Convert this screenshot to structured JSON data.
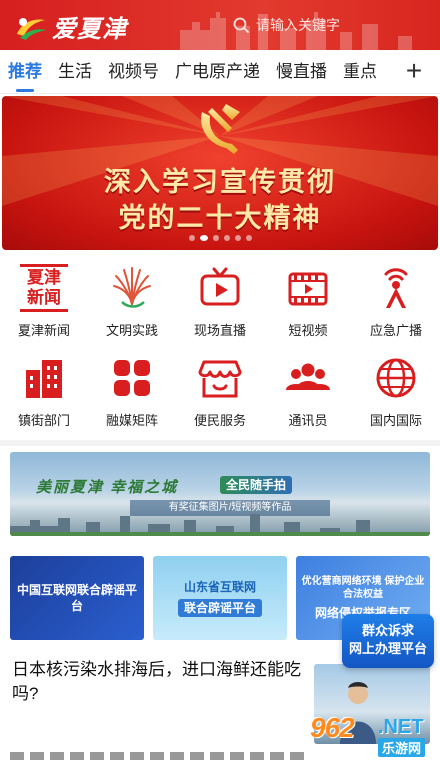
{
  "header": {
    "app_name": "爱夏津",
    "search_placeholder": "请输入关键字",
    "brand_color": "#d61f1f"
  },
  "tabs": {
    "items": [
      "推荐",
      "生活",
      "视频号",
      "广电原产递",
      "慢直播",
      "重点"
    ],
    "active_index": 0,
    "add_icon": "plus-icon",
    "active_color": "#2a7ae2"
  },
  "banner": {
    "line1": "深入学习宣传贯彻",
    "line2": "党的二十大精神",
    "emblem": "party-emblem-icon",
    "slide_count": 6,
    "active_slide": 1
  },
  "grid": {
    "row1": [
      {
        "label": "夏津新闻",
        "logo_text": "夏津\n新闻",
        "icon": "xiajin-news-logo"
      },
      {
        "label": "文明实践",
        "icon": "civilization-practice-icon"
      },
      {
        "label": "现场直播",
        "icon": "tv-play-icon"
      },
      {
        "label": "短视频",
        "icon": "film-icon"
      },
      {
        "label": "应急广播",
        "icon": "broadcast-tower-icon"
      }
    ],
    "row2": [
      {
        "label": "镇街部门",
        "icon": "buildings-icon"
      },
      {
        "label": "融媒矩阵",
        "icon": "matrix-grid-icon"
      },
      {
        "label": "便民服务",
        "icon": "shop-icon"
      },
      {
        "label": "通讯员",
        "icon": "people-icon"
      },
      {
        "label": "国内国际",
        "icon": "globe-icon"
      }
    ]
  },
  "photo_banner": {
    "title": "美丽夏津 幸福之城",
    "badge": "全民随手拍",
    "subtitle": "有奖征集图片/短视频等作品"
  },
  "cards": [
    {
      "text": "中国互联网联合辟谣平台"
    },
    {
      "text": "山东省互联网",
      "text2": "联合辟谣平台"
    },
    {
      "text": "优化营商网络环境 保护企业合法权益",
      "text2": "网络侵权举报专区"
    }
  ],
  "float_button": {
    "line1": "群众诉求",
    "line2": "网上办理平台"
  },
  "article": {
    "title": "日本核污染水排海后，进口海鲜还能吃吗?"
  },
  "watermark": {
    "num": "962",
    "net": ".NET",
    "cn": "乐游网"
  }
}
